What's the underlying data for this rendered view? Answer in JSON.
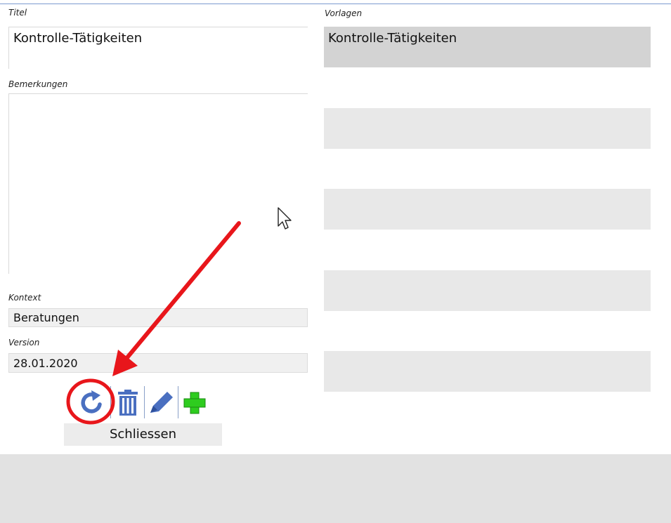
{
  "form": {
    "titel_label": "Titel",
    "titel_value": "Kontrolle-Tätigkeiten",
    "bemerkungen_label": "Bemerkungen",
    "bemerkungen_value": "",
    "kontext_label": "Kontext",
    "kontext_value": "Beratungen",
    "version_label": "Version",
    "version_value": "28.01.2020"
  },
  "vorlagen": {
    "label": "Vorlagen",
    "items": [
      "Kontrolle-Tätigkeiten",
      "",
      "",
      "",
      ""
    ]
  },
  "toolbar": {
    "icons": [
      "refresh-icon",
      "trash-icon",
      "edit-pencil-icon",
      "add-plus-icon"
    ],
    "close_label": "Schliessen"
  },
  "colors": {
    "icon_blue": "#4a6fc0",
    "add_green": "#2ecc1f",
    "annotation_red": "#e8161b"
  }
}
